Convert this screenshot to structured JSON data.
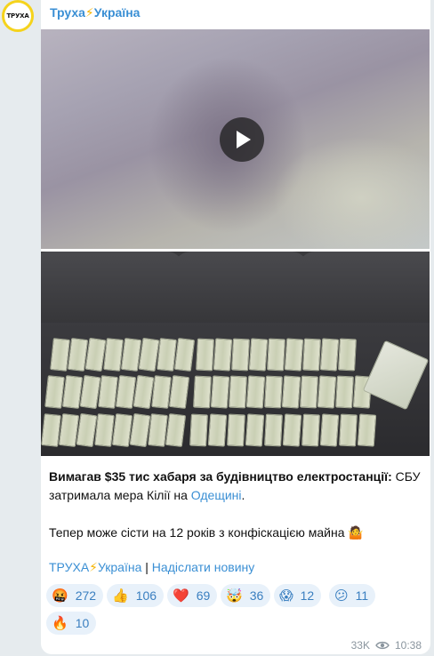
{
  "channel": {
    "name": "Труха",
    "bolt": "⚡",
    "name_rest": "Україна",
    "avatar_text": "ТРУХА"
  },
  "video": {
    "play_label": ""
  },
  "caption": {
    "bold": "Вимагав $35 тис хабаря за будівництво електростанції:",
    "rest": " СБУ затримала мера Кілії на ",
    "link": "Одещині",
    "end": ".",
    "line2": "Тепер може сісти на 12 років з конфіскацією майна",
    "line2_emoji": "🤷"
  },
  "footer_links": {
    "part1": "ТРУХА",
    "bolt": "⚡",
    "part2": "Україна",
    "sep": " | ",
    "submit": "Надіслати новину"
  },
  "reactions": [
    {
      "emoji": "🤬",
      "count": "272"
    },
    {
      "emoji": "👍",
      "count": "106"
    },
    {
      "emoji": "❤️",
      "count": "69"
    },
    {
      "emoji": "🤯",
      "count": "36"
    },
    {
      "emoji": "😱",
      "count": "12"
    },
    {
      "emoji": "😕",
      "count": "11"
    },
    {
      "emoji": "🔥",
      "count": "10"
    }
  ],
  "meta": {
    "views": "33K",
    "time": "10:38"
  },
  "colors": {
    "accent": "#3a8fd4",
    "reaction_bg": "#e8f1fa",
    "bolt": "#f5b400"
  }
}
